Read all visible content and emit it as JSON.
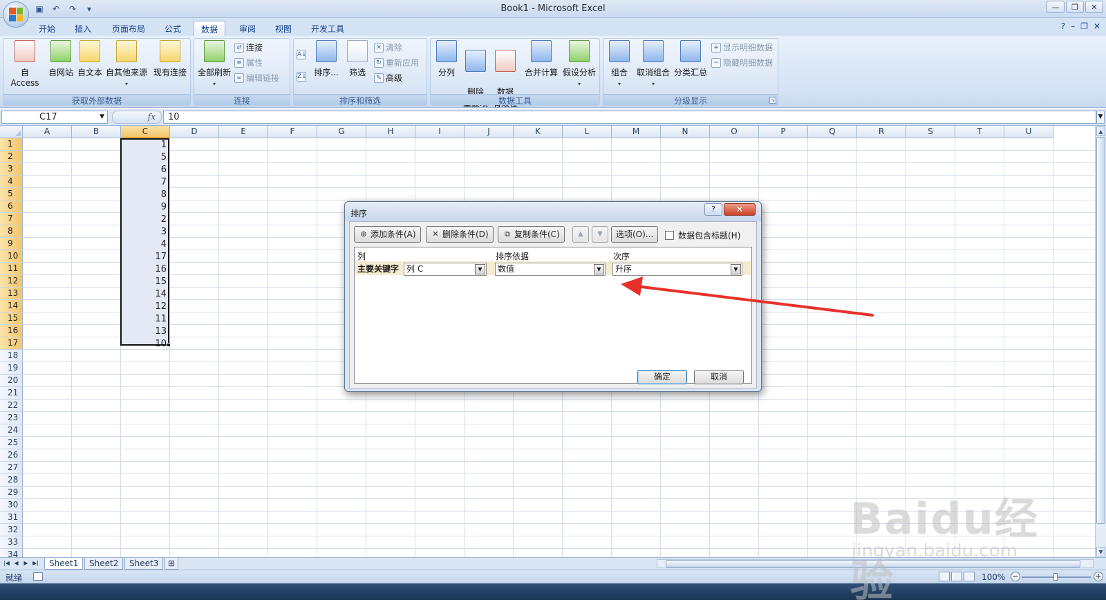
{
  "window": {
    "title": "Book1 - Microsoft Excel",
    "controls": [
      "—",
      "❐",
      "✕"
    ]
  },
  "ribbon_tabs": [
    "开始",
    "插入",
    "页面布局",
    "公式",
    "数据",
    "审阅",
    "视图",
    "开发工具"
  ],
  "active_tab": "数据",
  "ribbon": {
    "get_external": {
      "label": "获取外部数据",
      "buttons": [
        "自 Access",
        "自网站",
        "自文本",
        "自其他来源",
        "现有连接"
      ]
    },
    "connections": {
      "label": "连接",
      "refresh_all": "全部刷新",
      "small": [
        "连接",
        "属性",
        "编辑链接"
      ]
    },
    "sort_filter": {
      "label": "排序和筛选",
      "sort": "排序...",
      "filter": "筛选",
      "small": [
        "清除",
        "重新应用",
        "高级"
      ]
    },
    "data_tools": {
      "label": "数据工具",
      "buttons": [
        "分列",
        "删除\n重复项",
        "数据\n有效性",
        "合并计算",
        "假设分析"
      ]
    },
    "outline": {
      "label": "分级显示",
      "buttons": [
        "组合",
        "取消组合",
        "分类汇总"
      ],
      "small": [
        "显示明细数据",
        "隐藏明细数据"
      ]
    }
  },
  "formula_bar": {
    "name_box": "C17",
    "fx": "fx",
    "value": "10"
  },
  "columns": [
    "A",
    "B",
    "C",
    "D",
    "E",
    "F",
    "G",
    "H",
    "I",
    "J",
    "K",
    "L",
    "M",
    "N",
    "O",
    "P",
    "Q",
    "R",
    "S",
    "T",
    "U"
  ],
  "selected_column": "C",
  "rows": [
    "1",
    "2",
    "3",
    "4",
    "5",
    "6",
    "7",
    "8",
    "9",
    "10",
    "11",
    "12",
    "13",
    "14",
    "15",
    "16",
    "17",
    "18",
    "19",
    "20",
    "21",
    "22",
    "23",
    "24",
    "25",
    "26",
    "27",
    "28",
    "29",
    "30",
    "31",
    "32",
    "33",
    "34"
  ],
  "column_c_values": [
    "1",
    "5",
    "6",
    "7",
    "8",
    "9",
    "2",
    "3",
    "4",
    "17",
    "16",
    "15",
    "14",
    "12",
    "11",
    "13",
    "10"
  ],
  "sheet_tabs": [
    "Sheet1",
    "Sheet2",
    "Sheet3"
  ],
  "active_sheet": "Sheet1",
  "status": {
    "ready": "就绪",
    "zoom": "100%"
  },
  "dialog": {
    "title": "排序",
    "help": "?",
    "close": "✕",
    "add_level": "添加条件(A)",
    "delete_level": "删除条件(D)",
    "copy_level": "复制条件(C)",
    "options": "选项(O)...",
    "has_headers": "数据包含标题(H)",
    "has_headers_checked": false,
    "headers": {
      "column": "列",
      "sort_on": "排序依据",
      "order": "次序"
    },
    "row": {
      "label": "主要关键字",
      "column": "列 C",
      "sort_on": "数值",
      "order": "升序"
    },
    "ok": "确定",
    "cancel": "取消"
  },
  "annotation_color": "#e8302a",
  "watermark": {
    "logo": "Baidu经验",
    "url": "jingyan.baidu.com"
  }
}
